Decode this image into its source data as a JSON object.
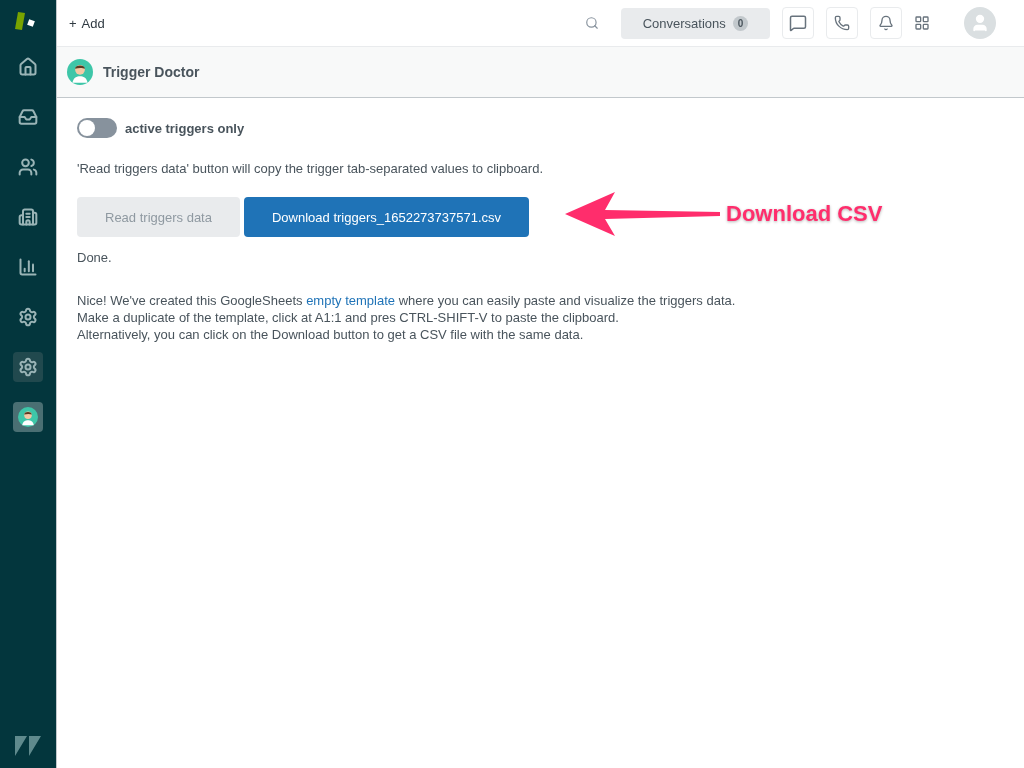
{
  "sidebar": {
    "items": [
      {
        "kind": "nav",
        "selected": false
      },
      {
        "kind": "nav",
        "selected": false
      },
      {
        "kind": "nav",
        "selected": false
      },
      {
        "kind": "nav",
        "selected": false
      },
      {
        "kind": "nav",
        "selected": false
      },
      {
        "kind": "nav",
        "selected": false
      },
      {
        "kind": "app",
        "selected": false
      },
      {
        "kind": "app",
        "selected": true
      }
    ]
  },
  "topbar": {
    "add": {
      "icon": "+",
      "label": "Add"
    },
    "conversations": {
      "label": "Conversations",
      "count": "0"
    }
  },
  "app_header": {
    "title": "Trigger Doctor"
  },
  "toggle": {
    "label": "active triggers only",
    "on": false
  },
  "description": "'Read triggers data' button will copy the trigger tab-separated values to clipboard.",
  "buttons": [
    {
      "label": "Read triggers data",
      "kind": "secondary",
      "disabled": true
    },
    {
      "label": "Download triggers_1652273737571.csv",
      "kind": "primary",
      "disabled": false
    }
  ],
  "status": "Done.",
  "info": [
    {
      "before": "Nice! We've created this GoogleSheets ",
      "link": "empty template",
      "after": " where you can easily paste and visualize the triggers data."
    },
    {
      "before": "Make a duplicate of the template, click at A1:1 and pres CTRL-SHIFT-V to paste the clipboard."
    },
    {
      "before": "Alternatively, you can click on the Download button to get a CSV file with the same data."
    }
  ],
  "annotation": {
    "label": "Download CSV"
  }
}
